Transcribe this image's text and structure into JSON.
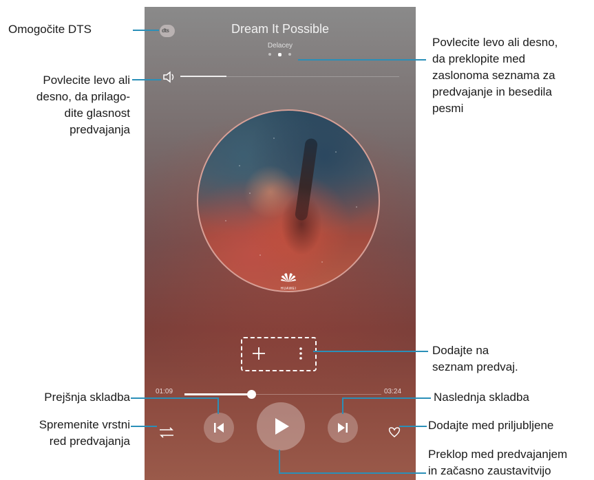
{
  "app": {
    "title": "Dream It Possible",
    "artist": "Delacey"
  },
  "dts_badge": "dts",
  "album_logo": "HUAWEI",
  "player": {
    "time_elapsed": "01:09",
    "time_total": "03:24",
    "progress": 0.338,
    "volume_level": 0.21,
    "page_indicator": {
      "count": 3,
      "active": 1
    }
  },
  "icons": {
    "dts": "dts-icon",
    "volume": "speaker-icon",
    "add": "plus-icon",
    "more": "more-vertical-icon",
    "shuffle": "shuffle-icon",
    "previous": "skip-previous-icon",
    "play": "play-icon",
    "next": "skip-next-icon",
    "favorite": "heart-icon"
  },
  "annotations": {
    "dts": "Omogočite DTS",
    "volume": [
      "Povlecite levo ali",
      "desno, da prilago-",
      "dite glasnost",
      "predvajanja"
    ],
    "swipe": [
      "Povlecite levo ali desno,",
      "da preklopite med",
      "zaslonoma seznama za",
      "predvajanje in besedila",
      "pesmi"
    ],
    "add_playlist": [
      "Dodajte na",
      "seznam predvaj."
    ],
    "previous": "Prejšnja skladba",
    "next": "Naslednja skladba",
    "order": [
      "Spremenite vrstni",
      "red predvajanja"
    ],
    "favorite": "Dodajte med priljubljene",
    "play_pause": [
      "Preklop med predvajanjem",
      "in začasno zaustavitvijo"
    ]
  },
  "colors": {
    "annotation_line": "#2a8fb8"
  }
}
